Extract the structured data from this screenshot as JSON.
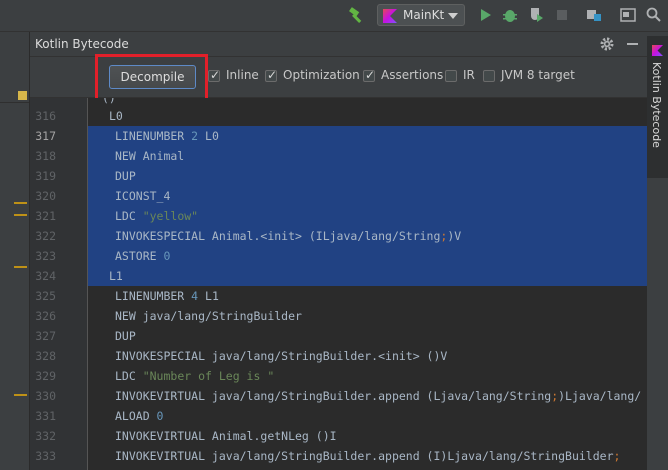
{
  "toolbar": {
    "run_config": "MainKt",
    "icons": [
      "hammer-icon",
      "run-icon",
      "debug-icon",
      "coverage-icon",
      "stop-icon",
      "project-structure-icon",
      "terminal-icon",
      "search-icon"
    ]
  },
  "tool_window": {
    "title": "Kotlin Bytecode",
    "side_label": "Kotlin Bytecode",
    "decompile_label": "Decompile",
    "options": [
      {
        "label": "Inline",
        "checked": true
      },
      {
        "label": "Optimization",
        "checked": true
      },
      {
        "label": "Assertions",
        "checked": true
      },
      {
        "label": "IR",
        "checked": false
      },
      {
        "label": "JVM 8 target",
        "checked": false
      }
    ]
  },
  "colors": {
    "selection": "#214283",
    "number": "#6897bb",
    "string": "#6a8759",
    "keyword": "#cc7832",
    "highlight_box": "#e2202a"
  },
  "code_lines": [
    {
      "num": "316",
      "label": true,
      "parts": [
        [
          "L0",
          ""
        ]
      ]
    },
    {
      "num": "317",
      "selected": true,
      "current": true,
      "parts": [
        [
          "LINENUMBER ",
          ""
        ],
        [
          "2",
          "num"
        ],
        [
          " L0",
          ""
        ]
      ]
    },
    {
      "num": "318",
      "selected": true,
      "parts": [
        [
          "NEW Animal",
          ""
        ]
      ]
    },
    {
      "num": "319",
      "selected": true,
      "parts": [
        [
          "DUP",
          ""
        ]
      ]
    },
    {
      "num": "320",
      "selected": true,
      "parts": [
        [
          "ICONST_4",
          ""
        ]
      ]
    },
    {
      "num": "321",
      "selected": true,
      "parts": [
        [
          "LDC ",
          ""
        ],
        [
          "\"yellow\"",
          "str"
        ]
      ]
    },
    {
      "num": "322",
      "selected": true,
      "parts": [
        [
          "INVOKESPECIAL Animal.<init> (ILjava/lang/String",
          ""
        ],
        [
          ";",
          "semi"
        ],
        [
          ")V",
          ""
        ]
      ]
    },
    {
      "num": "323",
      "selected": true,
      "parts": [
        [
          "ASTORE ",
          ""
        ],
        [
          "0",
          "num"
        ]
      ]
    },
    {
      "num": "324",
      "selected": true,
      "label": true,
      "parts": [
        [
          "L1",
          ""
        ]
      ]
    },
    {
      "num": "325",
      "parts": [
        [
          "LINENUMBER ",
          ""
        ],
        [
          "4",
          "num"
        ],
        [
          " L1",
          ""
        ]
      ]
    },
    {
      "num": "326",
      "parts": [
        [
          "NEW java/lang/StringBuilder",
          ""
        ]
      ]
    },
    {
      "num": "327",
      "parts": [
        [
          "DUP",
          ""
        ]
      ]
    },
    {
      "num": "328",
      "parts": [
        [
          "INVOKESPECIAL java/lang/StringBuilder.<init> ()V",
          ""
        ]
      ]
    },
    {
      "num": "329",
      "parts": [
        [
          "LDC ",
          ""
        ],
        [
          "\"Number of Leg is \"",
          "str"
        ]
      ]
    },
    {
      "num": "330",
      "parts": [
        [
          "INVOKEVIRTUAL java/lang/StringBuilder.append (Ljava/lang/String",
          ""
        ],
        [
          ";",
          "semi"
        ],
        [
          ")Ljava/lang/",
          ""
        ]
      ]
    },
    {
      "num": "331",
      "parts": [
        [
          "ALOAD ",
          ""
        ],
        [
          "0",
          "num"
        ]
      ]
    },
    {
      "num": "332",
      "parts": [
        [
          "INVOKEVIRTUAL Animal.getNLeg ()I",
          ""
        ]
      ]
    },
    {
      "num": "333",
      "parts": [
        [
          "INVOKEVIRTUAL java/lang/StringBuilder.append (I)Ljava/lang/StringBuilder",
          ""
        ],
        [
          ";",
          "semi"
        ]
      ]
    }
  ]
}
